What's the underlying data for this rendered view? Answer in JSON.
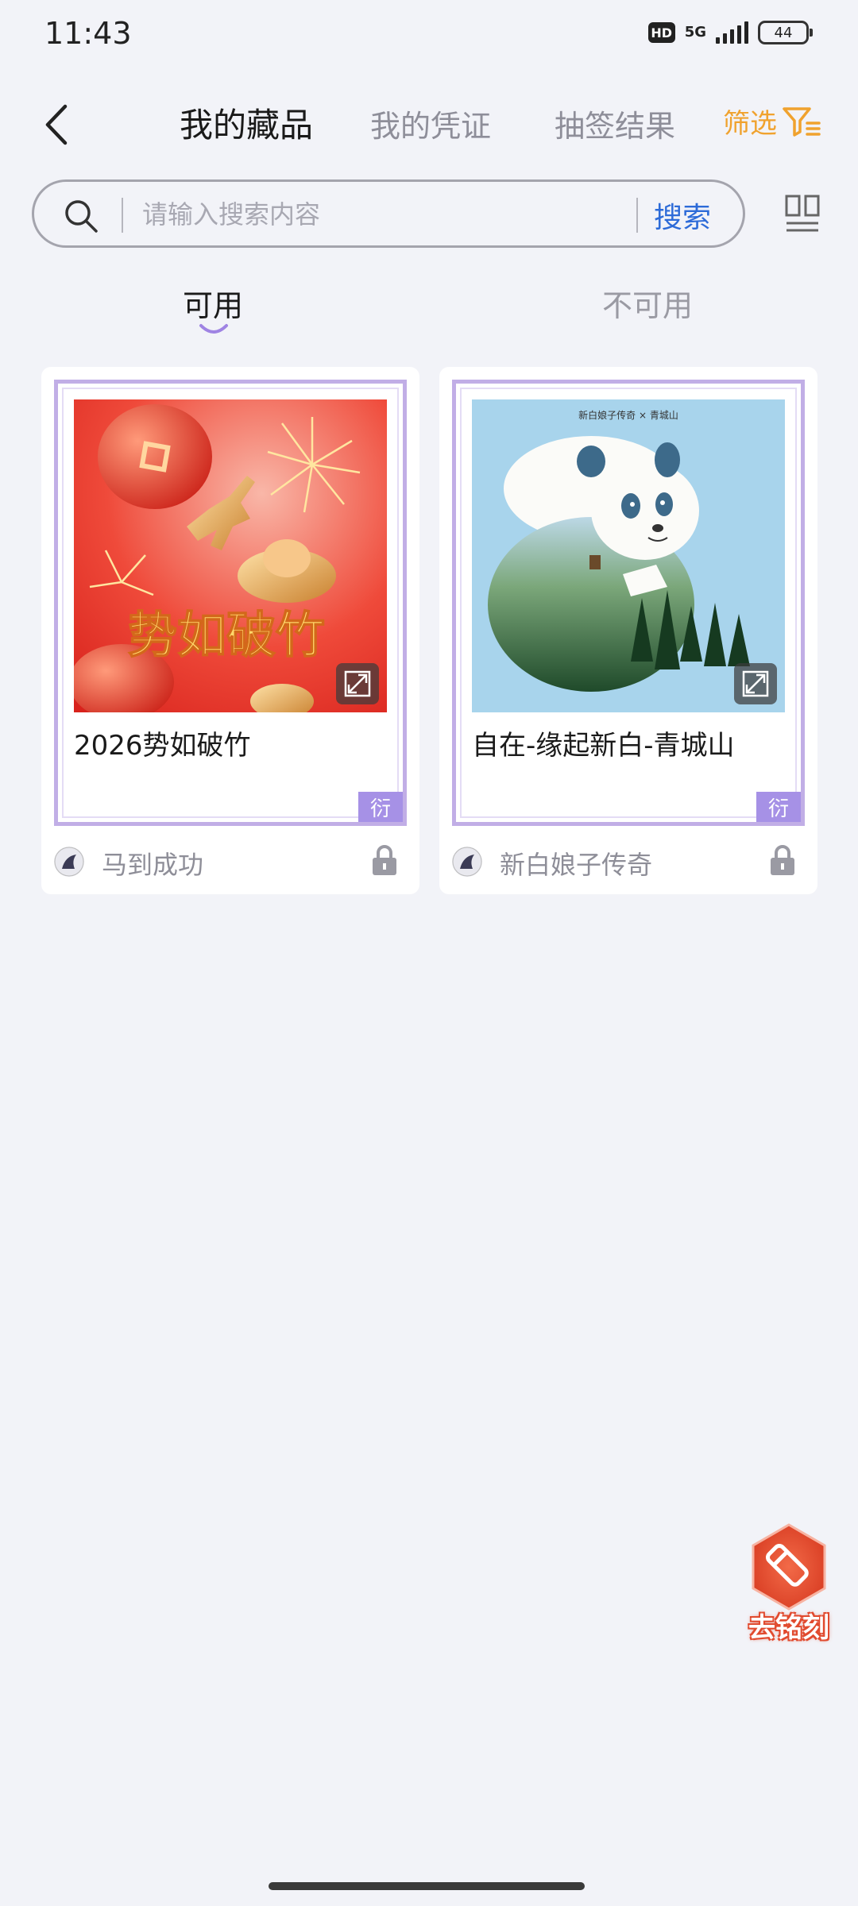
{
  "status_bar": {
    "time": "11:43",
    "hd": "HD",
    "network": "5G",
    "battery": "44"
  },
  "header": {
    "tabs": [
      "我的藏品",
      "我的凭证",
      "抽签结果"
    ],
    "active_tab": "我的藏品",
    "filter_label": "筛选",
    "accent_color": "#f0a22e"
  },
  "search": {
    "placeholder": "请输入搜索内容",
    "value": "",
    "button_label": "搜索"
  },
  "availability_tabs": {
    "available": "可用",
    "unavailable": "不可用",
    "active": "可用"
  },
  "collections": [
    {
      "image_text": "势如破竹",
      "title": "2026势如破竹",
      "tag": "衍",
      "creator": "马到成功",
      "locked": true
    },
    {
      "image_text": "新白娘子传奇 × 青城山",
      "title": "自在-缘起新白-青城山",
      "tag": "衍",
      "creator": "新白娘子传奇",
      "locked": true
    }
  ],
  "fab": {
    "label": "去铭刻",
    "icon": "pen-icon"
  },
  "colors": {
    "background": "#f2f3f8",
    "card_frame": "#c1aee6",
    "tag": "#a691e6",
    "link": "#2d6bd8",
    "fab": "#e14a2e"
  }
}
